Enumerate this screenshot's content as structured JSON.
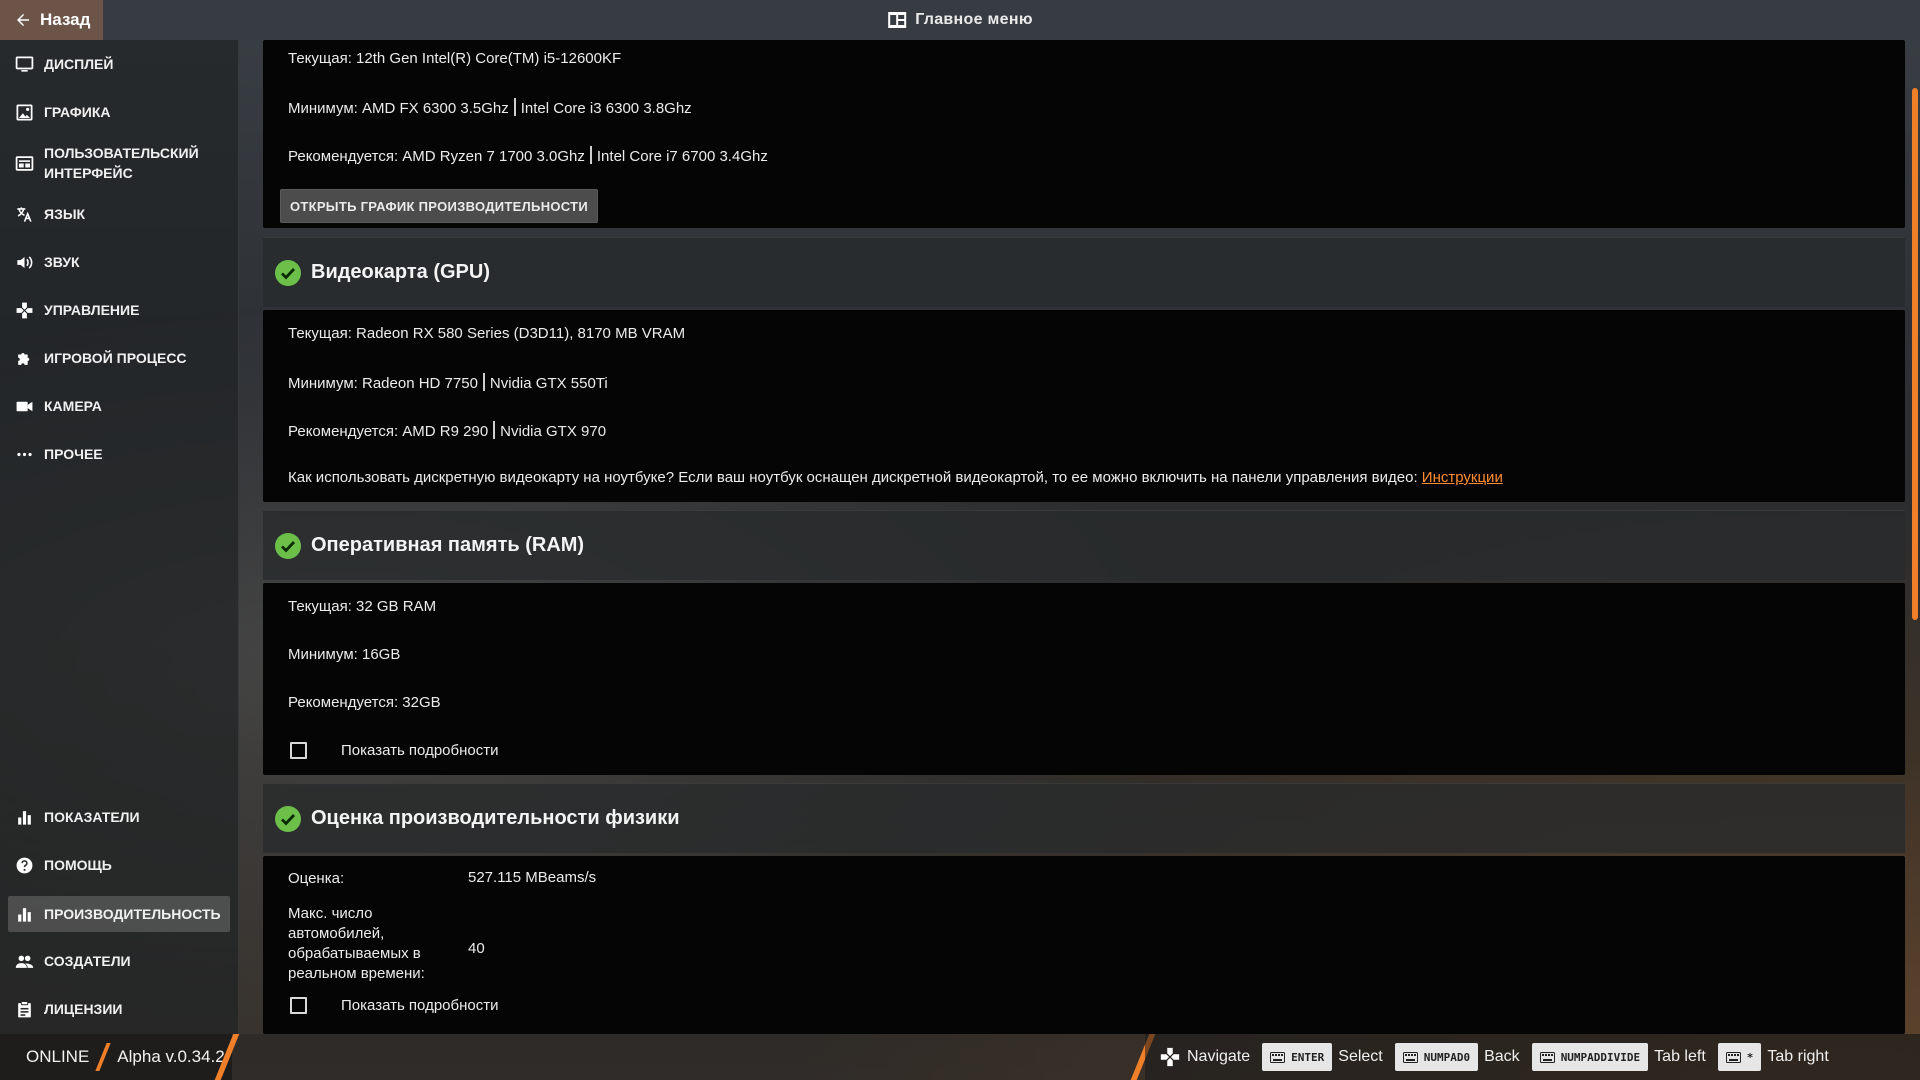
{
  "topbar": {
    "back_label": "Назад",
    "main_menu_label": "Главное меню"
  },
  "sidebar": {
    "items": [
      {
        "label": "Дисплей",
        "icon": "monitor-icon"
      },
      {
        "label": "Графика",
        "icon": "image-icon"
      },
      {
        "label": "Пользовательский интерфейс",
        "icon": "layout-icon"
      },
      {
        "label": "Язык",
        "icon": "translate-icon"
      },
      {
        "label": "Звук",
        "icon": "speaker-icon"
      },
      {
        "label": "Управление",
        "icon": "gamepad-icon"
      },
      {
        "label": "Игровой процесс",
        "icon": "puzzle-icon"
      },
      {
        "label": "Камера",
        "icon": "video-camera-icon"
      },
      {
        "label": "Прочее",
        "icon": "ellipsis-icon"
      }
    ],
    "bottom_items": [
      {
        "label": "Показатели",
        "icon": "bar-chart-icon"
      },
      {
        "label": "Помощь",
        "icon": "help-icon"
      },
      {
        "label": "Производительность",
        "icon": "performance-icon",
        "active": true
      },
      {
        "label": "Создатели",
        "icon": "people-icon"
      },
      {
        "label": "Лицензии",
        "icon": "clipboard-icon"
      }
    ]
  },
  "cpu": {
    "current": "Текущая: 12th Gen Intel(R) Core(TM) i5-12600KF",
    "min_a": "Минимум: AMD FX 6300 3.5Ghz",
    "min_b": "Intel Core i3 6300 3.8Ghz",
    "rec_a": "Рекомендуется: AMD Ryzen 7 1700 3.0Ghz",
    "rec_b": "Intel Core i7 6700 3.4Ghz",
    "perf_button": "Открыть график производительности"
  },
  "gpu": {
    "title": "Видеокарта (GPU)",
    "current": "Текущая: Radeon RX 580 Series (D3D11), 8170 MB VRAM",
    "min_a": "Минимум: Radeon HD 7750",
    "min_b": "Nvidia GTX 550Ti",
    "rec_a": "Рекомендуется: AMD R9 290",
    "rec_b": "Nvidia GTX 970",
    "laptop_text": "Как использовать дискретную видеокарту на ноутбуке? Если ваш ноутбук оснащен дискретной видеокартой, то ее можно включить на панели управления видео: ",
    "laptop_link": "Инструкции"
  },
  "ram": {
    "title": "Оперативная память (RAM)",
    "current": "Текущая: 32 GB RAM",
    "min": "Минимум: 16GB",
    "rec": "Рекомендуется: 32GB",
    "details_label": "Показать подробности"
  },
  "physics": {
    "title": "Оценка производительности физики",
    "score_key": "Оценка:",
    "score_value": "527.115 MBeams/s",
    "max_cars_key": "Макс. число автомобилей, обрабатываемых в реальном времени:",
    "max_cars_value": "40",
    "details_label": "Показать подробности"
  },
  "bottombar": {
    "status": "ONLINE",
    "version": "Alpha v.0.34.2",
    "hints": [
      {
        "key": "",
        "label": "Navigate"
      },
      {
        "key": "ENTER",
        "label": "Select"
      },
      {
        "key": "NUMPAD0",
        "label": "Back"
      },
      {
        "key": "NUMPADDIVIDE",
        "label": "Tab left"
      },
      {
        "key": "*",
        "label": "Tab right"
      }
    ]
  },
  "colors": {
    "accent": "#f07f2a",
    "check": "#6cc04a",
    "link": "#ff8c30"
  }
}
